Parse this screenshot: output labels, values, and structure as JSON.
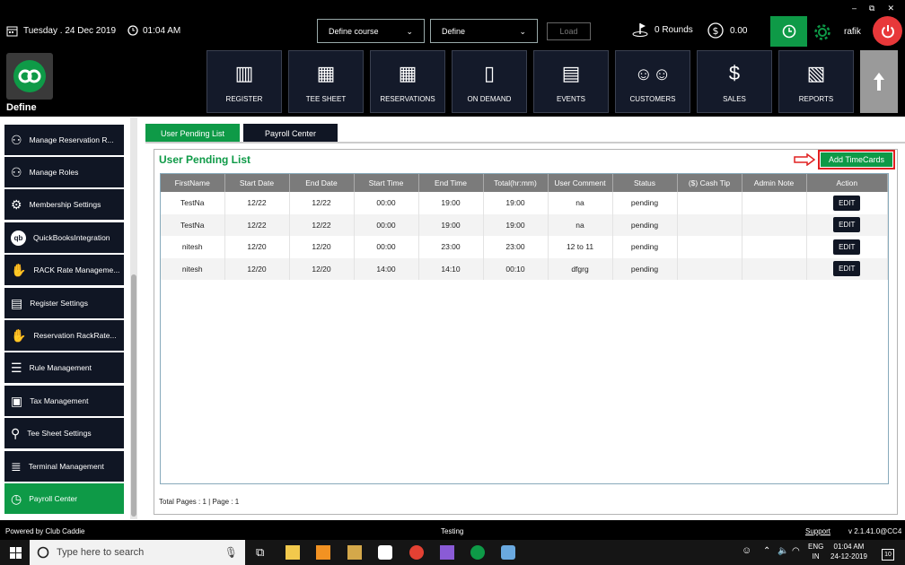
{
  "window_controls": {
    "minimize": "–",
    "restore": "⧉",
    "close": "✕"
  },
  "header": {
    "date": "Tuesday . 24 Dec 2019",
    "time": "01:04 AM",
    "course_select": "Define  course",
    "define_select": "Define",
    "load_label": "Load",
    "rounds": "0 Rounds",
    "amount": "0.00",
    "user": "rafik"
  },
  "brand": {
    "name": "Define"
  },
  "nav": [
    {
      "label": "REGISTER"
    },
    {
      "label": "TEE SHEET"
    },
    {
      "label": "RESERVATIONS"
    },
    {
      "label": "ON DEMAND"
    },
    {
      "label": "EVENTS"
    },
    {
      "label": "CUSTOMERS"
    },
    {
      "label": "SALES"
    },
    {
      "label": "REPORTS"
    }
  ],
  "sidebar": {
    "items": [
      {
        "label": "Manage Reservation R...",
        "icon": "hierarchy-icon"
      },
      {
        "label": "Manage Roles",
        "icon": "hierarchy-icon"
      },
      {
        "label": "Membership Settings",
        "icon": "gear-icon"
      },
      {
        "label": "QuickBooksIntegration",
        "icon": "quickbooks-icon"
      },
      {
        "label": "RACK Rate Manageme...",
        "icon": "rate-icon"
      },
      {
        "label": "Register Settings",
        "icon": "register-icon"
      },
      {
        "label": "Reservation RackRate...",
        "icon": "rate-icon"
      },
      {
        "label": "Rule Management",
        "icon": "document-icon"
      },
      {
        "label": "Tax Management",
        "icon": "tax-icon"
      },
      {
        "label": "Tee Sheet Settings",
        "icon": "tee-icon"
      },
      {
        "label": "Terminal Management",
        "icon": "terminal-icon"
      },
      {
        "label": "Payroll Center",
        "icon": "clock-icon"
      }
    ]
  },
  "tabs": [
    {
      "label": "User Pending List"
    },
    {
      "label": "Payroll Center"
    }
  ],
  "panel": {
    "title": "User Pending List",
    "add_button": "Add TimeCards",
    "pager": "Total Pages : 1 | Page : 1"
  },
  "table": {
    "columns": [
      "FirstName",
      "Start Date",
      "End Date",
      "Start Time",
      "End Time",
      "Total(hr:mm)",
      "User Comment",
      "Status",
      "($) Cash Tip",
      "Admin Note",
      "Action"
    ],
    "rows": [
      [
        "TestNa",
        "12/22",
        "12/22",
        "00:00",
        "19:00",
        "19:00",
        "na",
        "pending",
        "",
        "",
        "EDIT"
      ],
      [
        "TestNa",
        "12/22",
        "12/22",
        "00:00",
        "19:00",
        "19:00",
        "na",
        "pending",
        "",
        "",
        "EDIT"
      ],
      [
        "nitesh",
        "12/20",
        "12/20",
        "00:00",
        "23:00",
        "23:00",
        "12 to 11",
        "pending",
        "",
        "",
        "EDIT"
      ],
      [
        "nitesh",
        "12/20",
        "12/20",
        "14:00",
        "14:10",
        "00:10",
        "dfgrg",
        "pending",
        "",
        "",
        "EDIT"
      ]
    ]
  },
  "statusbar": {
    "powered": "Powered by Club Caddie",
    "center": "Testing",
    "support": "Support",
    "version": "v 2.1.41.0@CC4"
  },
  "taskbar": {
    "search_placeholder": "Type here to search",
    "lang": "ENG",
    "region": "IN",
    "clock": "01:04 AM",
    "date": "24-12-2019",
    "notifications": "10"
  },
  "colors": {
    "accent": "#0e9a47",
    "danger": "#e8383a",
    "nav": "#141a2a"
  }
}
